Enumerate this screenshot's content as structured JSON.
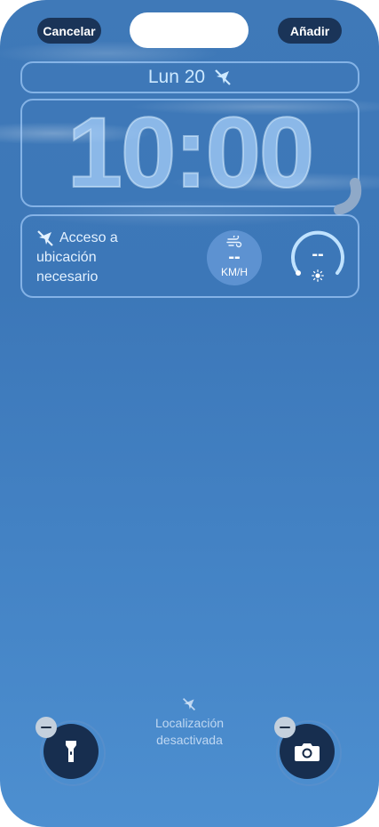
{
  "header": {
    "cancel_label": "Cancelar",
    "add_label": "Añadir"
  },
  "lockscreen": {
    "date": "Lun 20",
    "date_icon": "location-off-icon",
    "time": "10:00"
  },
  "widgets": {
    "location_line1": "Acceso a",
    "location_line2": "ubicación",
    "location_line3": "necesario",
    "wind_value": "--",
    "wind_unit": "KM/H",
    "uv_value": "--",
    "uv_icon": "sun-icon",
    "wind_icon": "wind-icon"
  },
  "bottom": {
    "flashlight_icon": "flashlight-icon",
    "camera_icon": "camera-icon",
    "status_line1": "Localización",
    "status_line2": "desactivada"
  },
  "colors": {
    "background_top": "#3f79b8",
    "background_bottom": "#4d8fd0",
    "button_dark": "#142846"
  }
}
